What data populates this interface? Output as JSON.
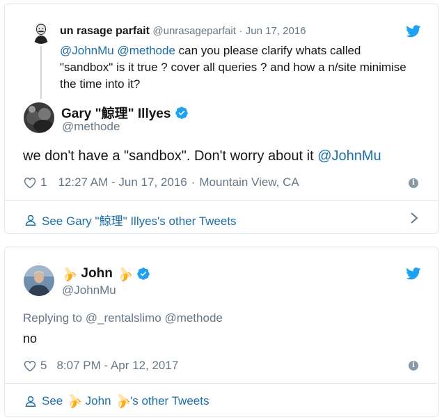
{
  "tweet1": {
    "reply": {
      "name": "un rasage parfait",
      "handle": "@unrasageparfait",
      "separator": "·",
      "date": "Jun 17, 2016",
      "text_mention1": "@JohnMu",
      "text_mention2": "@methode",
      "text_line1_rest": "can you please clarify whats called",
      "text_line2": "\"sandbox\" is it true ? cover all queries ? and how a n/site minimise",
      "text_line3": "the time into it?"
    },
    "author": {
      "name": "Gary \"鯨理\" Illyes",
      "handle": "@methode"
    },
    "text": "we don't have a \"sandbox\". Don't worry about it",
    "text_mention": "@JohnMu",
    "likes": "1",
    "timestamp": "12:27 AM - Jun 17, 2016",
    "separator": "·",
    "location": "Mountain View, CA",
    "footer_link": "See Gary \"鯨理\" Illyes's other Tweets"
  },
  "tweet2": {
    "author": {
      "name": "John",
      "handle": "@JohnMu",
      "emoji": "🍌"
    },
    "replying_prefix": "Replying to",
    "replying_to1": "@_rentalslimo",
    "replying_to2": "@methode",
    "text": "no",
    "likes": "5",
    "timestamp": "8:07 PM - Apr 12, 2017",
    "footer_prefix": "See",
    "footer_name": "John",
    "footer_suffix": "'s other Tweets"
  },
  "colors": {
    "link": "#1b6ea8",
    "muted": "#657786",
    "twitter_blue": "#1da1f2",
    "border": "#e1e8ed",
    "banana": "#f2b233"
  }
}
